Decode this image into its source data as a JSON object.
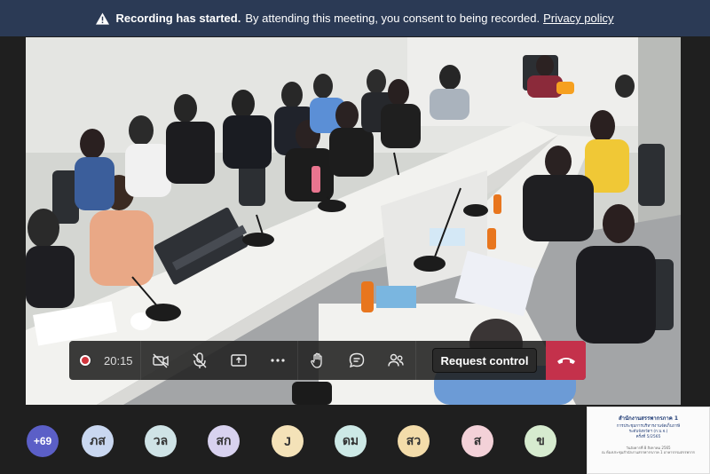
{
  "banner": {
    "title": "Recording has started.",
    "message": "By attending this meeting, you consent to being recorded.",
    "link": "Privacy policy",
    "icon": "warning-icon"
  },
  "video": {
    "description_icon": "video-feed"
  },
  "controls": {
    "recording_time": "20:15",
    "camera_icon": "camera-off-icon",
    "mic_icon": "mic-off-icon",
    "share_icon": "share-screen-icon",
    "more_icon": "more-icon",
    "raise_hand_icon": "raise-hand-icon",
    "chat_icon": "chat-icon",
    "people_icon": "people-icon",
    "request_control_label": "Request control",
    "hangup_icon": "hang-up-icon",
    "hangup_color": "#c4314b"
  },
  "participants": {
    "overflow_label": "+69",
    "avatars": [
      {
        "initials": "ภส",
        "color": "#c9d7f0"
      },
      {
        "initials": "วล",
        "color": "#cfe3e6"
      },
      {
        "initials": "สก",
        "color": "#d8d2ef"
      },
      {
        "initials": "J",
        "color": "#f4e2b8"
      },
      {
        "initials": "ดม",
        "color": "#cde9e6"
      },
      {
        "initials": "สว",
        "color": "#f3dcaa"
      },
      {
        "initials": "ส",
        "color": "#f3d1d8"
      },
      {
        "initials": "ข",
        "color": "#d6ebcf"
      }
    ]
  },
  "shared_slide": {
    "line1": "สำนักงานสรรพากรภาค 1",
    "line2": "การประชุมการบริหารงานจัดเก็บภาษี",
    "line3": "ระดับจังหวัดฯ (ก.บ.จ.)",
    "line4": "ครั้งที่ 5/2565",
    "line5": "วันอังคารที่ 8 สิงหาคม 2565",
    "line6": "ณ ห้องประชุมสำนักงานสรรพากรภาค 1 อาคารกรมสรรพากร"
  }
}
